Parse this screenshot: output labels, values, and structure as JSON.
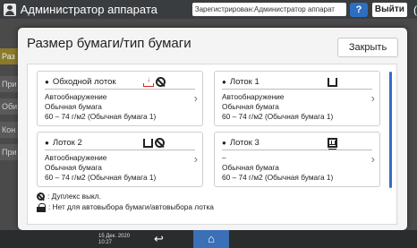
{
  "topbar": {
    "title": "Администратор аппарата",
    "user_field": "Зарегистрирован:Администратор аппарат",
    "help_label": "?",
    "logout_label": "Выйти",
    "extra_glyph": "("
  },
  "background": {
    "side_items": [
      "Раз",
      "При",
      "Оби",
      "Кон",
      "При"
    ]
  },
  "dialog": {
    "title": "Размер бумаги/тип бумаги",
    "close_label": "Закрыть",
    "cards": [
      {
        "name": "Обходной лоток",
        "line1": "Автообнаружение",
        "line2": "Обычная бумага",
        "line3": "60 – 74 г/м2 (Обычная бумага 1)"
      },
      {
        "name": "Лоток 1",
        "line1": "Автообнаружение",
        "line2": "Обычная бумага",
        "line3": "60 – 74 г/м2 (Обычная бумага 1)"
      },
      {
        "name": "Лоток 2",
        "line1": "Автообнаружение",
        "line2": "Обычная бумага",
        "line3": "60 – 74 г/м2 (Обычная бумага 1)"
      },
      {
        "name": "Лоток 3",
        "line1": "–",
        "line2": "Обычная бумага",
        "line3": "60 – 74 г/м2 (Обычная бумага 1)"
      }
    ],
    "legend": {
      "nodup_text": ": Дуплекс выкл.",
      "noauto_text": ": Нет для автовыбора бумаги/автовыбора лотка"
    }
  },
  "bottombar": {
    "date": "15 Дек. 2020",
    "time": "10:27"
  }
}
